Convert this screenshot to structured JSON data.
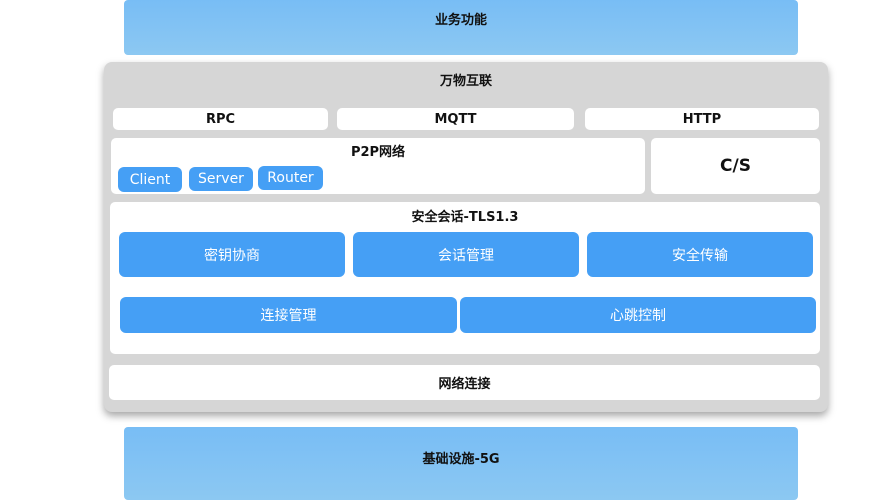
{
  "top_layer": {
    "label": "业务功能"
  },
  "iot": {
    "title": "万物互联",
    "protocols": [
      "RPC",
      "MQTT",
      "HTTP"
    ],
    "p2p": {
      "title": "P2P网络",
      "roles": [
        "Client",
        "Server",
        "Router"
      ]
    },
    "cs": {
      "label": "C/S"
    },
    "tls": {
      "title": "安全会话-TLS1.3",
      "row1": [
        "密钥协商",
        "会话管理",
        "安全传输"
      ],
      "row2": [
        "连接管理",
        "心跳控制"
      ]
    },
    "network": {
      "label": "网络连接"
    }
  },
  "bottom_layer": {
    "label": "基础设施-5G"
  },
  "colors": {
    "accent": "#459ff5",
    "band": "#7cc0f5",
    "panel": "#d6d6d6"
  }
}
